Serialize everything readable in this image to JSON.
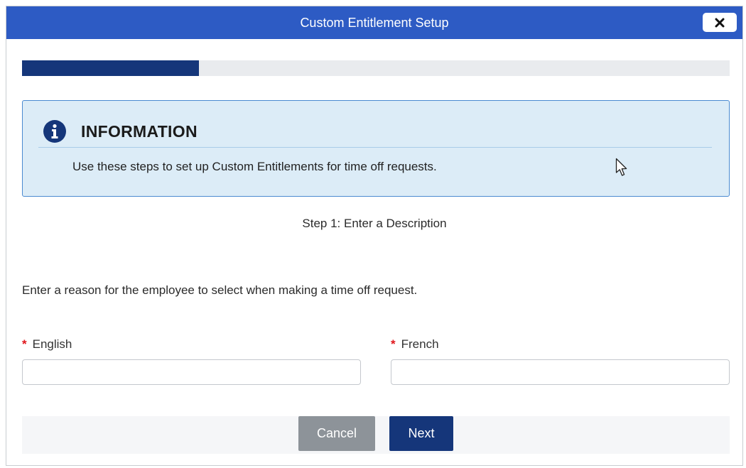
{
  "dialog": {
    "title": "Custom Entitlement Setup",
    "close_label": "×"
  },
  "progress": {
    "fraction": 0.25,
    "color": "#15367a",
    "track_color": "#e9ebee"
  },
  "info": {
    "icon": "info-circle-icon",
    "heading": "INFORMATION",
    "message": "Use these steps to set up Custom Entitlements for time off requests."
  },
  "step": {
    "label": "Step 1: Enter a Description"
  },
  "form": {
    "instruction": "Enter a reason for the employee to select when making a time off request.",
    "required_marker": "*",
    "fields": [
      {
        "label": "English",
        "value": "",
        "placeholder": ""
      },
      {
        "label": "French",
        "value": "",
        "placeholder": ""
      }
    ]
  },
  "footer": {
    "cancel_label": "Cancel",
    "next_label": "Next"
  },
  "colors": {
    "titlebar": "#2d5bc4",
    "primary": "#15367a",
    "info_bg": "#dcecf7",
    "info_border": "#4a8ad1",
    "required": "#e0161b",
    "cancel_bg": "#8d9399"
  }
}
